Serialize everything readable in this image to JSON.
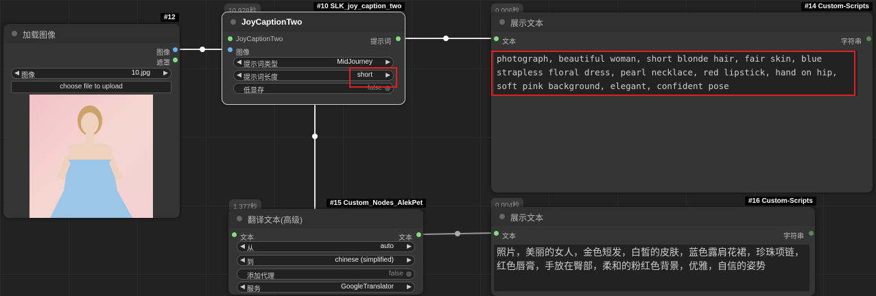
{
  "load_image_node": {
    "badge": "#12",
    "title": "加载图像",
    "out_image": "图像",
    "out_mask": "遮罩",
    "image_widget_label": "图像",
    "image_widget_value": "10.jpg",
    "upload_button": "choose file to upload"
  },
  "joy_node": {
    "timer": "10.928秒",
    "badge": "#10 SLK_joy_caption_two",
    "title": "JoyCaptionTwo",
    "in_joy": "JoyCaptionTwo",
    "in_image": "图像",
    "out_prompt": "提示词",
    "w1_label": "提示词类型",
    "w1_value": "MidJourney",
    "w2_label": "提示词长度",
    "w2_value": "short",
    "w3_label": "低显存",
    "w3_value": "false"
  },
  "show_text_14": {
    "timer": "0.006秒",
    "badge": "#14 Custom-Scripts",
    "title": "展示文本",
    "in_text": "文本",
    "out_string": "字符串",
    "content": "photograph, beautiful woman, short blonde hair, fair skin, blue strapless floral dress, pearl necklace, red lipstick, hand on hip, soft pink background, elegant, confident pose"
  },
  "translate_node": {
    "timer": "1.377秒",
    "badge": "#15 Custom_Nodes_AlekPet",
    "title": "翻译文本(高级)",
    "in_text": "文本",
    "out_text": "文本",
    "w1_label": "从",
    "w1_value": "auto",
    "w2_label": "到",
    "w2_value": "chinese (simplified)",
    "w3_label": "添加代理",
    "w3_value": "false",
    "w4_label": "服务",
    "w4_value": "GoogleTranslator"
  },
  "show_text_16": {
    "timer": "0.004秒",
    "badge": "#16 Custom-Scripts",
    "title": "展示文本",
    "in_text": "文本",
    "out_string": "字符串",
    "content": "照片，美丽的女人，金色短发，白皙的皮肤，蓝色露肩花裙，珍珠项链，红色唇膏，手放在臀部，柔和的粉红色背景，优雅，自信的姿势"
  },
  "colors": {
    "canvas": "#222222",
    "node": "#353535",
    "highlight": "#e02020",
    "wire": "#e6e6e6"
  }
}
